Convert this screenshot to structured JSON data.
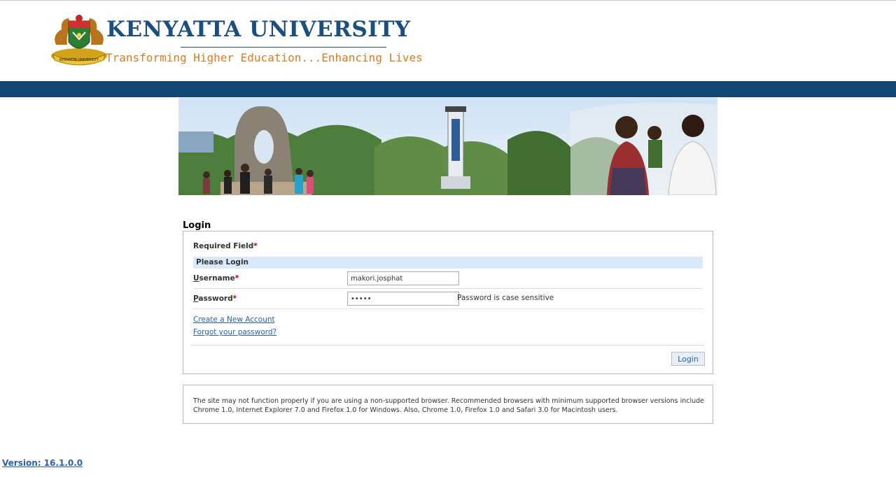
{
  "header": {
    "title": "KENYATTA UNIVERSITY",
    "tagline": "Transforming Higher Education...Enhancing Lives",
    "logo_text": "KENYATTA UNIVERSITY"
  },
  "login": {
    "heading": "Login",
    "required_field": "Required Field",
    "required_marker": "*",
    "please_login": "Please Login",
    "username_label": {
      "first": "U",
      "rest": "sername"
    },
    "username_value": "makori.josphat",
    "password_label": {
      "first": "P",
      "rest": "assword"
    },
    "password_value": "mmmmm",
    "password_hint": "Password is case sensitive",
    "create_account": "Create a New Account",
    "forgot_password": "Forgot your password?",
    "login_button": "Login"
  },
  "notice": "The site may not function properly if you are using a non-supported browser. Recommended browsers with minimum supported browser versions include Chrome 1.0, Internet Explorer 7.0 and Firefox 1.0 for Windows. Also, Chrome 1.0, Firefox 1.0 and Safari 3.0 for Macintosh users.",
  "footer": {
    "version": "Version: 16.1.0.0"
  },
  "colors": {
    "brand_blue": "#1c4f80",
    "nav_blue": "#0f4673",
    "tagline_orange": "#e07a1f",
    "link_blue": "#2b5fb3",
    "required_red": "#c00000",
    "please_bar": "#d8eafc"
  }
}
